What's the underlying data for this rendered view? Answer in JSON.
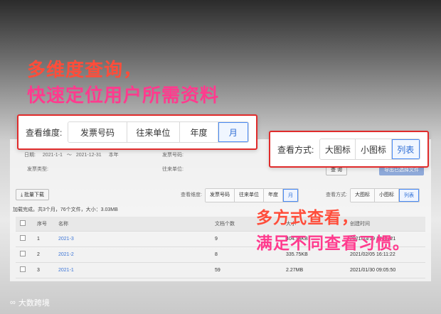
{
  "headline": {
    "line1": "多维度查询，",
    "line2": "快速定位用户所需资料",
    "line3": "多方式查看，",
    "line4": "满足不同查看习惯。"
  },
  "dimension_callout": {
    "label": "查看维度:",
    "options": [
      "发票号码",
      "往来单位",
      "年度",
      "月"
    ],
    "active": "月"
  },
  "view_callout": {
    "label": "查看方式:",
    "options": [
      "大图标",
      "小图标",
      "列表"
    ],
    "active": "列表"
  },
  "filters": {
    "date_label": "日期:",
    "date_from": "2021-1-1",
    "date_to": "2021-12-31",
    "period": "本年",
    "invoice_label": "发票号码:",
    "type_label": "发票类型:",
    "partner_label": "往来单位:",
    "query_button": "查 询",
    "export_button": "导出已选择文件"
  },
  "toolbar": {
    "batch_download": "批量下载",
    "dimension_label": "查看维度:",
    "dimension_options": [
      "发票号码",
      "往来单位",
      "年度",
      "月"
    ],
    "view_label": "查看方式:",
    "view_options": [
      "大图标",
      "小图标",
      "列表"
    ]
  },
  "status_text": "加载完成。共3个月，76个文件，大小：3.03MB",
  "table": {
    "headers": [
      "序号",
      "名称",
      "文档个数",
      "大小",
      "创建时间"
    ],
    "rows": [
      {
        "index": "1",
        "name": "2021-3",
        "count": "9",
        "size": "404.14KB",
        "time": "2021/03/19 17:05:21"
      },
      {
        "index": "2",
        "name": "2021-2",
        "count": "8",
        "size": "335.75KB",
        "time": "2021/02/05 16:11:22"
      },
      {
        "index": "3",
        "name": "2021-1",
        "count": "59",
        "size": "2.27MB",
        "time": "2021/01/30 09:05:50"
      }
    ]
  },
  "logo_text": "大数跨境"
}
